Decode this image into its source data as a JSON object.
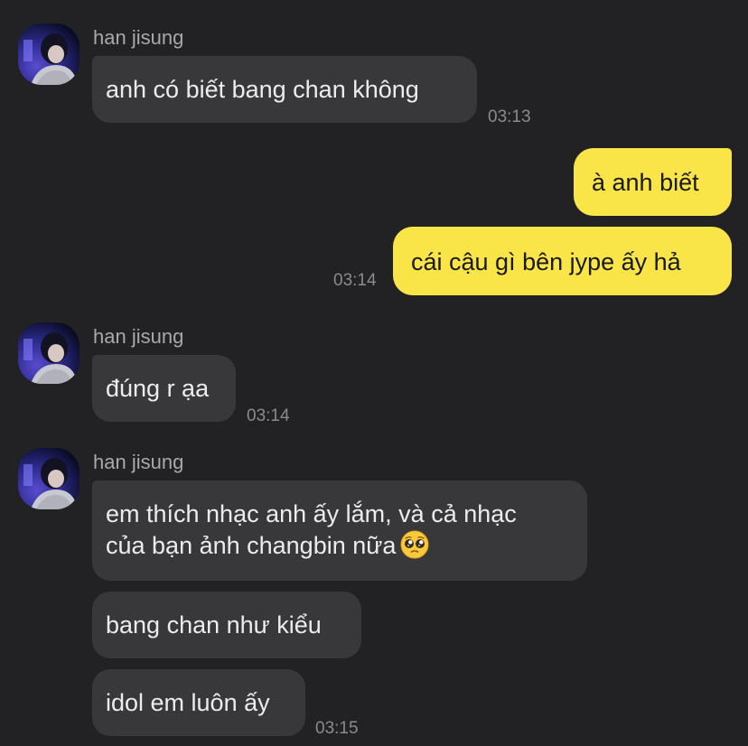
{
  "theme": {
    "background": "#222224",
    "incoming_bubble": "#38383b",
    "outgoing_bubble": "#f9e547",
    "sender_text": "#a8a8ad",
    "timestamp_text": "#8a8a8f"
  },
  "groups": [
    {
      "sender": "han jisung",
      "messages": [
        "anh có biết bang chan không"
      ],
      "time": "03:13"
    },
    {
      "outgoing": true,
      "messages": [
        "à anh biết",
        "cái cậu gì bên jype ấy hả"
      ],
      "time": "03:14"
    },
    {
      "sender": "han jisung",
      "messages": [
        "đúng r ạa"
      ],
      "time": "03:14"
    },
    {
      "sender": "han jisung",
      "messages": [
        {
          "line1": "em thích nhạc anh ấy lắm, và cả nhạc",
          "line2": "của bạn ảnh changbin nữa",
          "emoji": "pleading-face-emoji"
        },
        "bang chan như kiểu",
        "idol em luôn ấy"
      ],
      "time": "03:15"
    }
  ]
}
